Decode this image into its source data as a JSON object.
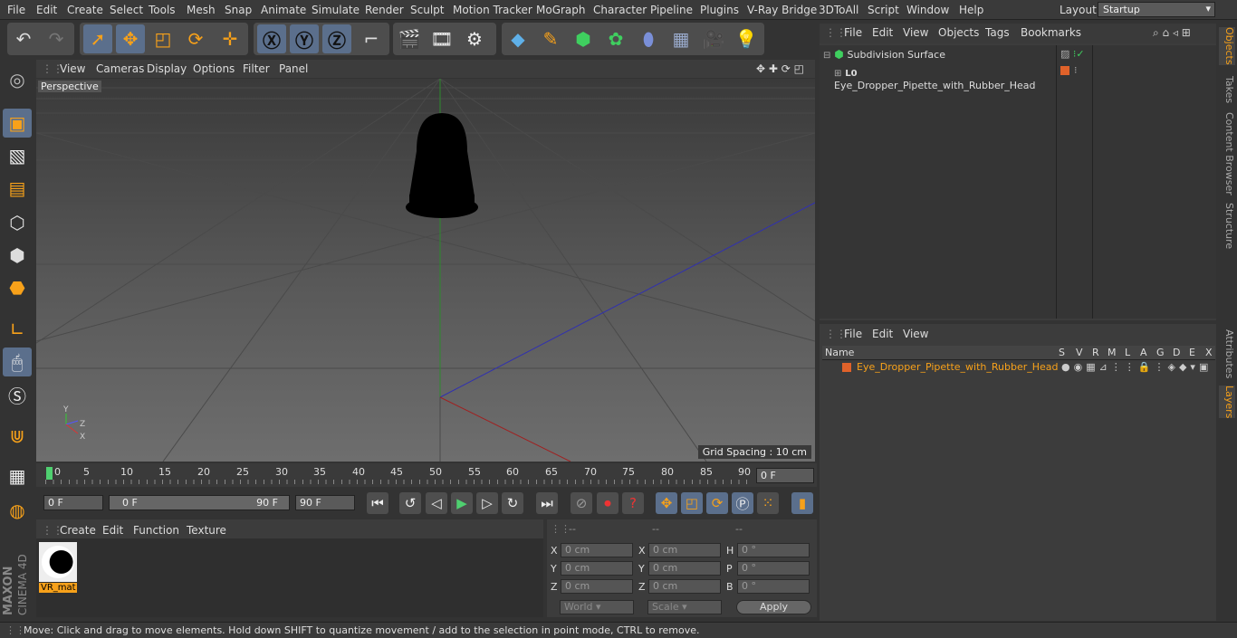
{
  "menubar": {
    "items": [
      "File",
      "Edit",
      "Create",
      "Select",
      "Tools",
      "Mesh",
      "Snap",
      "Animate",
      "Simulate",
      "Render",
      "Sculpt",
      "Motion Tracker",
      "MoGraph",
      "Character",
      "Pipeline",
      "Plugins",
      "V-Ray Bridge",
      "3DToAll",
      "Script",
      "Window",
      "Help"
    ],
    "layout_label": "Layout:",
    "layout_value": "Startup"
  },
  "viewport": {
    "menu": [
      "View",
      "Cameras",
      "Display",
      "Options",
      "Filter",
      "Panel"
    ],
    "camera": "Perspective",
    "grid_spacing": "Grid Spacing : 10 cm"
  },
  "timeline": {
    "ticks": [
      "0",
      "5",
      "10",
      "15",
      "20",
      "25",
      "30",
      "35",
      "40",
      "45",
      "50",
      "55",
      "60",
      "65",
      "70",
      "75",
      "80",
      "85",
      "90"
    ],
    "current": "0 F"
  },
  "playbar": {
    "start": "0 F",
    "range_start": "0 F",
    "range_end": "90 F",
    "end": "90 F"
  },
  "materials": {
    "menu": [
      "Create",
      "Edit",
      "Function",
      "Texture"
    ],
    "items": [
      {
        "name": "VR_mat"
      }
    ]
  },
  "coords": {
    "headers": [
      "--",
      "--",
      "--"
    ],
    "rows": [
      {
        "a": "X",
        "av": "0 cm",
        "b": "X",
        "bv": "0 cm",
        "c": "H",
        "cv": "0 °"
      },
      {
        "a": "Y",
        "av": "0 cm",
        "b": "Y",
        "bv": "0 cm",
        "c": "P",
        "cv": "0 °"
      },
      {
        "a": "Z",
        "av": "0 cm",
        "b": "Z",
        "bv": "0 cm",
        "c": "B",
        "cv": "0 °"
      }
    ],
    "world": "World",
    "scale": "Scale",
    "apply": "Apply"
  },
  "objects": {
    "menu": [
      "File",
      "Edit",
      "View",
      "Objects",
      "Tags",
      "Bookmarks"
    ],
    "items": [
      {
        "name": "Subdivision Surface"
      },
      {
        "name": "Eye_Dropper_Pipette_with_Rubber_Head"
      }
    ]
  },
  "layers": {
    "menu": [
      "File",
      "Edit",
      "View"
    ],
    "columns": [
      "Name",
      "S",
      "V",
      "R",
      "M",
      "L",
      "A",
      "G",
      "D",
      "E",
      "X"
    ],
    "items": [
      {
        "name": "Eye_Dropper_Pipette_with_Rubber_Head"
      }
    ]
  },
  "right_tabs": [
    "Objects",
    "Takes",
    "Content Browser",
    "Structure",
    "Attributes",
    "Layers"
  ],
  "status": "Move: Click and drag to move elements. Hold down SHIFT to quantize movement / add to the selection in point mode, CTRL to remove.",
  "brand": {
    "line1": "MAXON",
    "line2": "CINEMA 4D"
  },
  "colors": {
    "accent": "#f7a11a",
    "layer": "#e0622a",
    "selected_text": "#f7a11a"
  }
}
